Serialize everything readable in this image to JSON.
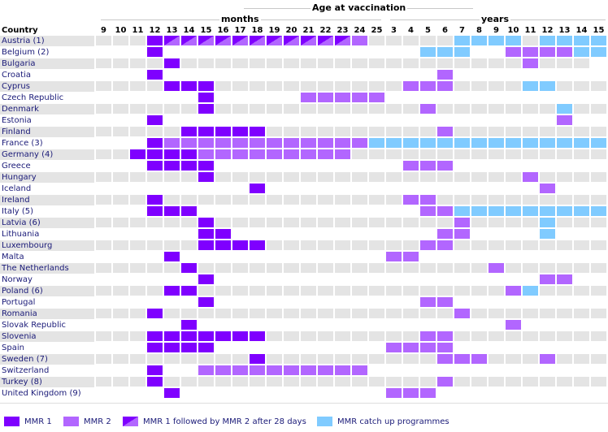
{
  "title": "Age at vaccination",
  "months_label": "months",
  "years_label": "years",
  "country_header": "Country",
  "colors": {
    "mmr1": "#7f00ff",
    "mmr2": "#b266ff",
    "catchup": "#80cbff",
    "empty": "#e4e4e4"
  },
  "chart_data": {
    "type": "table",
    "title": "Age at vaccination",
    "column_groups": [
      {
        "label": "months",
        "columns": [
          "9",
          "10",
          "11",
          "12",
          "13",
          "14",
          "15",
          "16",
          "17",
          "18",
          "19",
          "20",
          "21",
          "22",
          "23",
          "24",
          "25"
        ]
      },
      {
        "label": "years",
        "columns": [
          "3",
          "4",
          "5",
          "6",
          "7",
          "8",
          "9",
          "10",
          "11",
          "12",
          "13",
          "14",
          "15"
        ]
      }
    ],
    "legend_codes": {
      "a": "MMR 1",
      "b": "MMR 2",
      "h": "MMR 1 followed by MMR 2 after 28 days",
      "c": "MMR catch up programmes",
      ".": "none"
    },
    "rows": [
      {
        "country": "Austria (1)",
        "cells": "...ahhhhhhhhhhhb.....cccc.cccc"
      },
      {
        "country": "Belgium (2)",
        "cells": "...a...............ccc..bbbbcc"
      },
      {
        "country": "Bulgaria",
        "cells": "....a....................b..."
      },
      {
        "country": "Croatia",
        "cells": "...a................b........."
      },
      {
        "country": "Cyprus",
        "cells": "....aaa...........bbb....cc..."
      },
      {
        "country": "Czech Republic",
        "cells": "......a.....bbbbb............."
      },
      {
        "country": "Denmark",
        "cells": "......a............b.......c..."
      },
      {
        "country": "Estonia",
        "cells": "...a.......................b.."
      },
      {
        "country": "Finland",
        "cells": ".....aaaaa..........b........."
      },
      {
        "country": "France (3)",
        "cells": "...abbbbbbbbbbbbcccccccccccccc"
      },
      {
        "country": "Germany (4)",
        "cells": "..aaaabbbbbbbbb..............."
      },
      {
        "country": "Greece",
        "cells": "...aaaa...........bbb........."
      },
      {
        "country": "Hungary",
        "cells": "......a..................b...."
      },
      {
        "country": "Iceland",
        "cells": ".........a................b..."
      },
      {
        "country": "Ireland",
        "cells": "...a..............bb.........."
      },
      {
        "country": "Italy (5)",
        "cells": "...aaa.............bbccccccccc"
      },
      {
        "country": "Latvia (6)",
        "cells": "......a..............b....c..."
      },
      {
        "country": "Lithuania",
        "cells": "......aa............bb....c..."
      },
      {
        "country": "Luxembourg",
        "cells": "......aaaa.........bb........."
      },
      {
        "country": "Malta",
        "cells": "....a............bb..........."
      },
      {
        "country": "The Netherlands",
        "cells": ".....a.................b......"
      },
      {
        "country": "Norway",
        "cells": "......a...................bb.."
      },
      {
        "country": "Poland (6)",
        "cells": "....aa..................bc...."
      },
      {
        "country": "Portugal",
        "cells": "......a............bb........."
      },
      {
        "country": "Romania",
        "cells": "...a.................b........"
      },
      {
        "country": "Slovak Republic",
        "cells": ".....a..................b....."
      },
      {
        "country": "Slovenia",
        "cells": "...aaaaaaa.........bb........."
      },
      {
        "country": "Spain",
        "cells": "...aaaa..........bbbb........."
      },
      {
        "country": "Sweden (7)",
        "cells": ".........a..........bbb...b..."
      },
      {
        "country": "Switzerland",
        "cells": "...a..bbbbbbbbbb.............."
      },
      {
        "country": "Turkey (8)",
        "cells": "...a................b........."
      },
      {
        "country": "United Kingdom (9)",
        "cells": "....a............bbb.........."
      }
    ]
  },
  "legend": [
    {
      "code": "a",
      "label": "MMR 1"
    },
    {
      "code": "b",
      "label": "MMR 2"
    },
    {
      "code": "h",
      "label": "MMR 1 followed by MMR 2 after 28 days"
    },
    {
      "code": "c",
      "label": "MMR catch up programmes"
    }
  ]
}
